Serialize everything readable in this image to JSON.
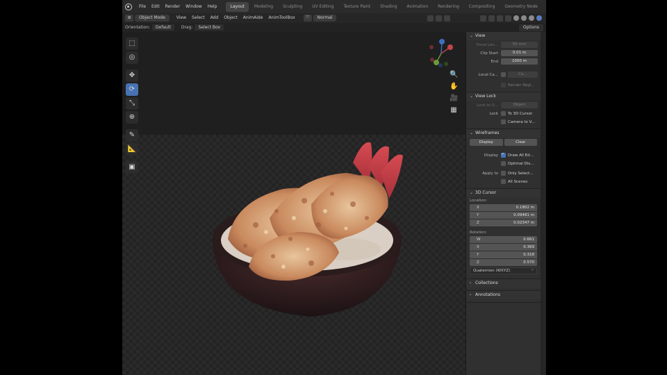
{
  "menu": [
    "File",
    "Edit",
    "Render",
    "Window",
    "Help"
  ],
  "workspaces": [
    {
      "label": "Layout",
      "active": true
    },
    {
      "label": "Modeling",
      "active": false
    },
    {
      "label": "Sculpting",
      "active": false
    },
    {
      "label": "UV Editing",
      "active": false
    },
    {
      "label": "Texture Paint",
      "active": false
    },
    {
      "label": "Shading",
      "active": false
    },
    {
      "label": "Animation",
      "active": false
    },
    {
      "label": "Rendering",
      "active": false
    },
    {
      "label": "Compositing",
      "active": false
    },
    {
      "label": "Geometry Node",
      "active": false
    }
  ],
  "header": {
    "mode": "Object Mode",
    "menus": [
      "View",
      "Select",
      "Add",
      "Object",
      "AnimAide",
      "AnimToolBox"
    ],
    "transform": "Normal"
  },
  "tool_settings": {
    "orientation_label": "Orientation:",
    "orientation_value": "Default",
    "drag_label": "Drag:",
    "drag_value": "Select Box",
    "options": "Options"
  },
  "sidebar": {
    "view": {
      "title": "View",
      "focal_label": "Focal Len...",
      "focal_value": "50 mm",
      "clip_start_label": "Clip Start",
      "clip_start_value": "0.01 m",
      "clip_end_label": "End",
      "clip_end_value": "1000 m",
      "local_camera_label": "Local Ca...",
      "local_camera_value": "Ca...",
      "render_region_label": "Render Regi..."
    },
    "view_lock": {
      "title": "View Lock",
      "lock_to_label": "Lock to O...",
      "lock_to_value": "Object",
      "lock_label": "Lock",
      "to_3d_cursor": "To 3D Cursor",
      "camera_to_view": "Camera to V..."
    },
    "wireframes": {
      "title": "Wireframes",
      "display_btn": "Display",
      "clear_btn": "Clear",
      "display_label": "Display",
      "draw_all_edges": "Draw All Ed...",
      "optimal_display": "Optimal Dis...",
      "apply_to_label": "Apply to",
      "only_selected": "Only Select...",
      "all_scenes": "All Scenes"
    },
    "cursor": {
      "title": "3D Cursor",
      "location_label": "Location:",
      "loc_x": "0.1802 m",
      "loc_y": "0.09481 m",
      "loc_z": "0.02347 m",
      "rotation_label": "Rotation:",
      "rot_w": "0.661",
      "rot_x": "0.369",
      "rot_y": "0.318",
      "rot_z": "0.570",
      "rotation_mode": "Quaternion (WXYZ)",
      "axis_x": "X",
      "axis_y": "Y",
      "axis_z": "Z",
      "axis_w": "W"
    },
    "collections": "Collections",
    "annotations": "Annotations"
  }
}
